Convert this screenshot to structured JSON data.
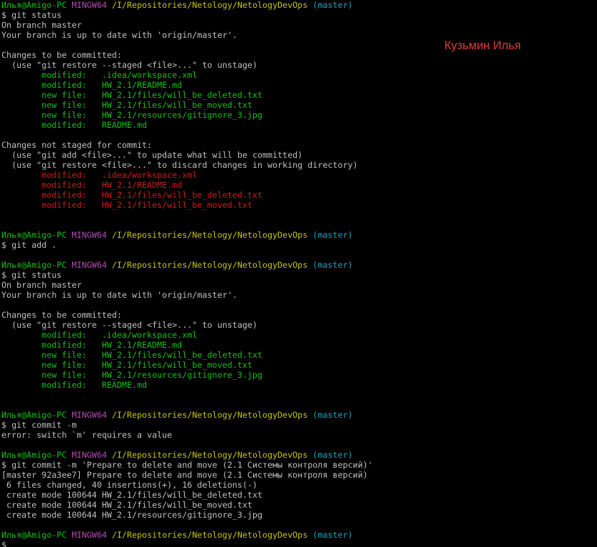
{
  "terminal": {
    "annotation": "Кузьмин Илья",
    "colors": {
      "background": "#000000",
      "user_host": "#13c113",
      "mingw": "#b54ab5",
      "path": "#c6c60b",
      "branch": "#16a5c0",
      "staged": "#13c113",
      "unstaged": "#d41818",
      "default": "#c0c0c0"
    },
    "lines": [
      [
        {
          "t": "Илья@Amigo-PC ",
          "c": "user"
        },
        {
          "t": "MINGW64 ",
          "c": "host"
        },
        {
          "t": "/I/Repositories/Netology/NetologyDevOps ",
          "c": "path"
        },
        {
          "t": "(master)",
          "c": "branch"
        }
      ],
      [
        {
          "t": "$ git status",
          "c": "default"
        }
      ],
      [
        {
          "t": "On branch master",
          "c": "default"
        }
      ],
      [
        {
          "t": "Your branch is up to date with 'origin/master'.",
          "c": "default"
        }
      ],
      [
        {
          "t": "",
          "c": "default"
        }
      ],
      [
        {
          "t": "Changes to be committed:",
          "c": "default"
        }
      ],
      [
        {
          "t": "  (use \"git restore --staged <file>...\" to unstage)",
          "c": "default"
        }
      ],
      [
        {
          "t": "        modified:   .idea/workspace.xml",
          "c": "green"
        }
      ],
      [
        {
          "t": "        modified:   HW_2.1/README.md",
          "c": "green"
        }
      ],
      [
        {
          "t": "        new file:   HW_2.1/files/will_be_deleted.txt",
          "c": "green"
        }
      ],
      [
        {
          "t": "        new file:   HW_2.1/files/will_be_moved.txt",
          "c": "green"
        }
      ],
      [
        {
          "t": "        new file:   HW_2.1/resources/gitignore_3.jpg",
          "c": "green"
        }
      ],
      [
        {
          "t": "        modified:   README.md",
          "c": "green"
        }
      ],
      [
        {
          "t": "",
          "c": "default"
        }
      ],
      [
        {
          "t": "Changes not staged for commit:",
          "c": "default"
        }
      ],
      [
        {
          "t": "  (use \"git add <file>...\" to update what will be committed)",
          "c": "default"
        }
      ],
      [
        {
          "t": "  (use \"git restore <file>...\" to discard changes in working directory)",
          "c": "default"
        }
      ],
      [
        {
          "t": "        modified:   .idea/workspace.xml",
          "c": "red"
        }
      ],
      [
        {
          "t": "        modified:   HW_2.1/README.md",
          "c": "red"
        }
      ],
      [
        {
          "t": "        modified:   HW_2.1/files/will_be_deleted.txt",
          "c": "red"
        }
      ],
      [
        {
          "t": "        modified:   HW_2.1/files/will_be_moved.txt",
          "c": "red"
        }
      ],
      [
        {
          "t": "",
          "c": "default"
        }
      ],
      [
        {
          "t": "",
          "c": "default"
        }
      ],
      [
        {
          "t": "Илья@Amigo-PC ",
          "c": "user"
        },
        {
          "t": "MINGW64 ",
          "c": "host"
        },
        {
          "t": "/I/Repositories/Netology/NetologyDevOps ",
          "c": "path"
        },
        {
          "t": "(master)",
          "c": "branch"
        }
      ],
      [
        {
          "t": "$ git add .",
          "c": "default"
        }
      ],
      [
        {
          "t": "",
          "c": "default"
        }
      ],
      [
        {
          "t": "Илья@Amigo-PC ",
          "c": "user"
        },
        {
          "t": "MINGW64 ",
          "c": "host"
        },
        {
          "t": "/I/Repositories/Netology/NetologyDevOps ",
          "c": "path"
        },
        {
          "t": "(master)",
          "c": "branch"
        }
      ],
      [
        {
          "t": "$ git status",
          "c": "default"
        }
      ],
      [
        {
          "t": "On branch master",
          "c": "default"
        }
      ],
      [
        {
          "t": "Your branch is up to date with 'origin/master'.",
          "c": "default"
        }
      ],
      [
        {
          "t": "",
          "c": "default"
        }
      ],
      [
        {
          "t": "Changes to be committed:",
          "c": "default"
        }
      ],
      [
        {
          "t": "  (use \"git restore --staged <file>...\" to unstage)",
          "c": "default"
        }
      ],
      [
        {
          "t": "        modified:   .idea/workspace.xml",
          "c": "green"
        }
      ],
      [
        {
          "t": "        modified:   HW_2.1/README.md",
          "c": "green"
        }
      ],
      [
        {
          "t": "        new file:   HW_2.1/files/will_be_deleted.txt",
          "c": "green"
        }
      ],
      [
        {
          "t": "        new file:   HW_2.1/files/will_be_moved.txt",
          "c": "green"
        }
      ],
      [
        {
          "t": "        new file:   HW_2.1/resources/gitignore_3.jpg",
          "c": "green"
        }
      ],
      [
        {
          "t": "        modified:   README.md",
          "c": "green"
        }
      ],
      [
        {
          "t": "",
          "c": "default"
        }
      ],
      [
        {
          "t": "",
          "c": "default"
        }
      ],
      [
        {
          "t": "Илья@Amigo-PC ",
          "c": "user"
        },
        {
          "t": "MINGW64 ",
          "c": "host"
        },
        {
          "t": "/I/Repositories/Netology/NetologyDevOps ",
          "c": "path"
        },
        {
          "t": "(master)",
          "c": "branch"
        }
      ],
      [
        {
          "t": "$ git commit -m",
          "c": "default"
        }
      ],
      [
        {
          "t": "error: switch `m' requires a value",
          "c": "default"
        }
      ],
      [
        {
          "t": "",
          "c": "default"
        }
      ],
      [
        {
          "t": "Илья@Amigo-PC ",
          "c": "user"
        },
        {
          "t": "MINGW64 ",
          "c": "host"
        },
        {
          "t": "/I/Repositories/Netology/NetologyDevOps ",
          "c": "path"
        },
        {
          "t": "(master)",
          "c": "branch"
        }
      ],
      [
        {
          "t": "$ git commit -m 'Prepare to delete and move (2.1 Системы контроля версий)'",
          "c": "default"
        }
      ],
      [
        {
          "t": "[master 92a3ee7] Prepare to delete and move (2.1 Системы контроля версий)",
          "c": "default"
        }
      ],
      [
        {
          "t": " 6 files changed, 40 insertions(+), 16 deletions(-)",
          "c": "default"
        }
      ],
      [
        {
          "t": " create mode 100644 HW_2.1/files/will_be_deleted.txt",
          "c": "default"
        }
      ],
      [
        {
          "t": " create mode 100644 HW_2.1/files/will_be_moved.txt",
          "c": "default"
        }
      ],
      [
        {
          "t": " create mode 100644 HW_2.1/resources/gitignore_3.jpg",
          "c": "default"
        }
      ],
      [
        {
          "t": "",
          "c": "default"
        }
      ],
      [
        {
          "t": "Илья@Amigo-PC ",
          "c": "user"
        },
        {
          "t": "MINGW64 ",
          "c": "host"
        },
        {
          "t": "/I/Repositories/Netology/NetologyDevOps ",
          "c": "path"
        },
        {
          "t": "(master)",
          "c": "branch"
        }
      ],
      [
        {
          "t": "$",
          "c": "default"
        }
      ]
    ]
  }
}
